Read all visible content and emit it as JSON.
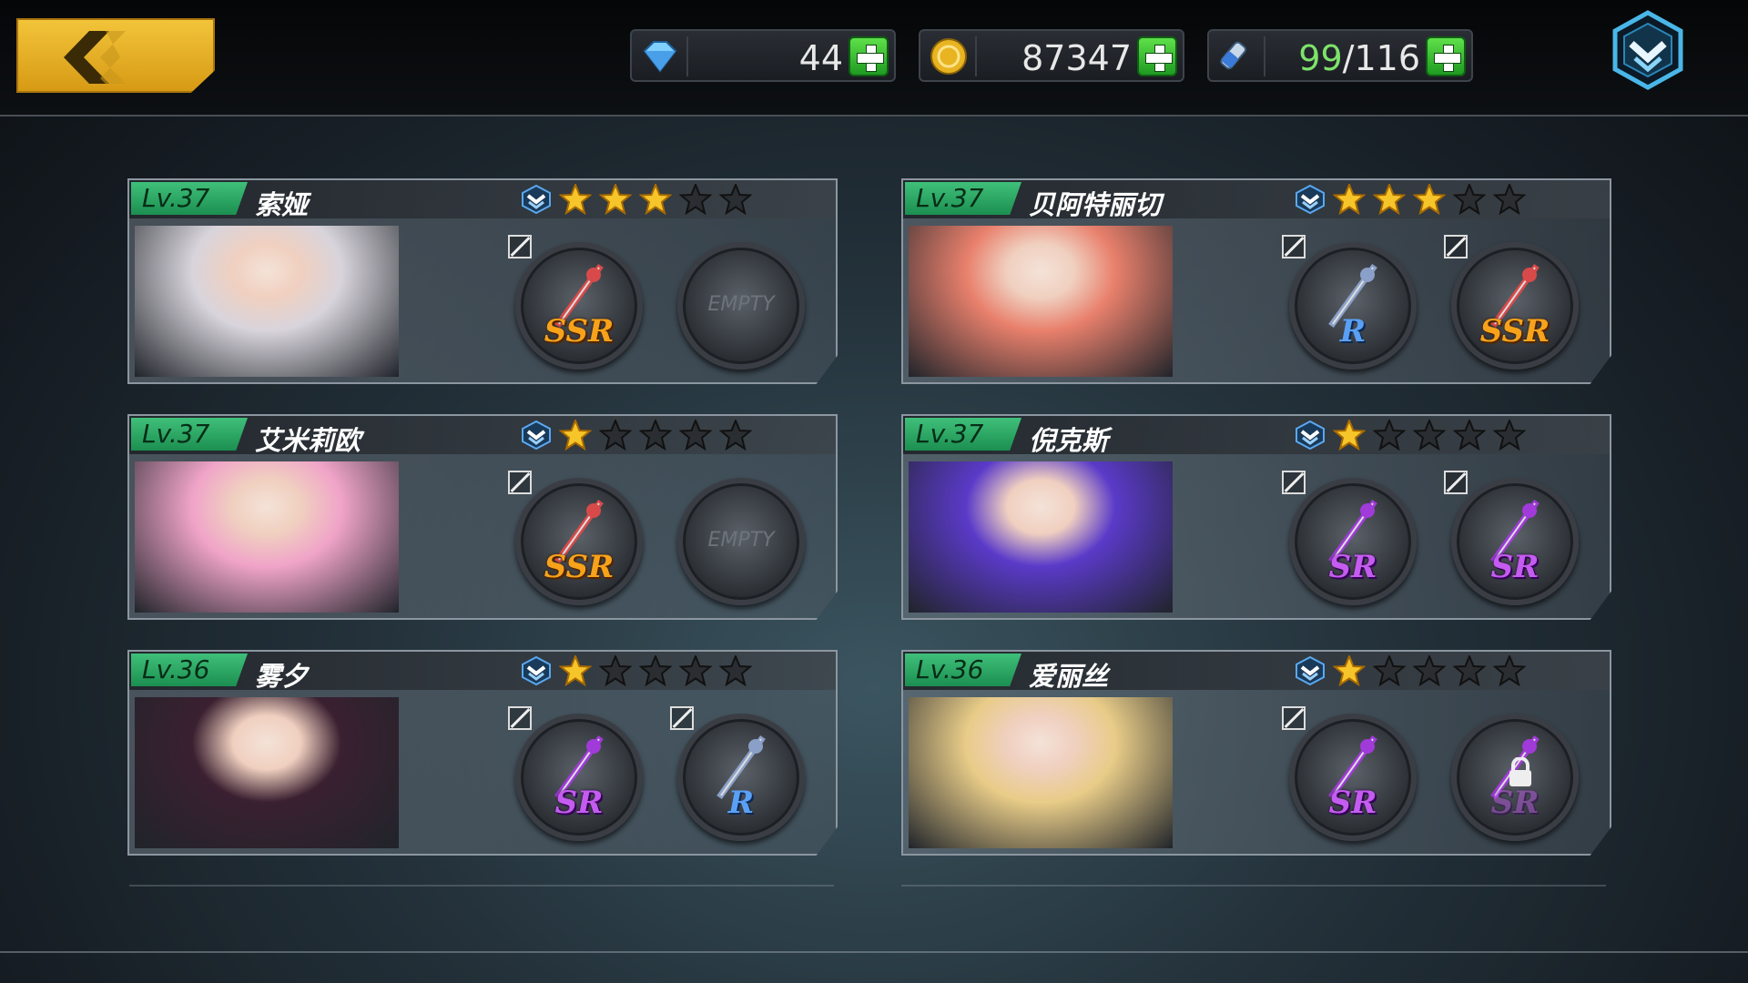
{
  "topbar": {
    "back_icon": "chevron-left-icon",
    "resources": [
      {
        "icon": "diamond-icon",
        "value": "44",
        "color": "#7fd0ff"
      },
      {
        "icon": "gold-coin-icon",
        "value": "87347",
        "color": "#f2c33a"
      },
      {
        "icon": "stamina-potion-icon",
        "value_current": "99",
        "value_sep": "/116",
        "color": "#7de36a"
      }
    ],
    "menu_icon": "chevron-down-shield-icon"
  },
  "characters": [
    {
      "level": "Lv.37",
      "name": "索娅",
      "stars": 3,
      "max_stars": 5,
      "slot1": "SSR",
      "slot2": "EMPTY",
      "portrait_color": "#d8d4dc"
    },
    {
      "level": "Lv.37",
      "name": "贝阿特丽切",
      "stars": 3,
      "max_stars": 5,
      "slot1": "R",
      "slot2": "SSR",
      "portrait_color": "#e8806c"
    },
    {
      "level": "Lv.37",
      "name": "艾米莉欧",
      "stars": 1,
      "max_stars": 5,
      "slot1": "SSR",
      "slot2": "EMPTY",
      "portrait_color": "#f0a4c8"
    },
    {
      "level": "Lv.37",
      "name": "倪克斯",
      "stars": 1,
      "max_stars": 5,
      "slot1": "SR",
      "slot2": "SR",
      "portrait_color": "#5a3ac8"
    },
    {
      "level": "Lv.36",
      "name": "雾夕",
      "stars": 1,
      "max_stars": 5,
      "slot1": "SR",
      "slot2": "R",
      "portrait_color": "#3a2030"
    },
    {
      "level": "Lv.36",
      "name": "爱丽丝",
      "stars": 1,
      "max_stars": 5,
      "slot1": "SR",
      "slot2": "SR",
      "slot2_locked": true,
      "portrait_color": "#e8cc88"
    }
  ],
  "colors": {
    "star_on": "#f6c52a",
    "star_off": "#2a2d31",
    "level_badge": "#2aa864",
    "rank_badge": "#5aa8f0"
  }
}
